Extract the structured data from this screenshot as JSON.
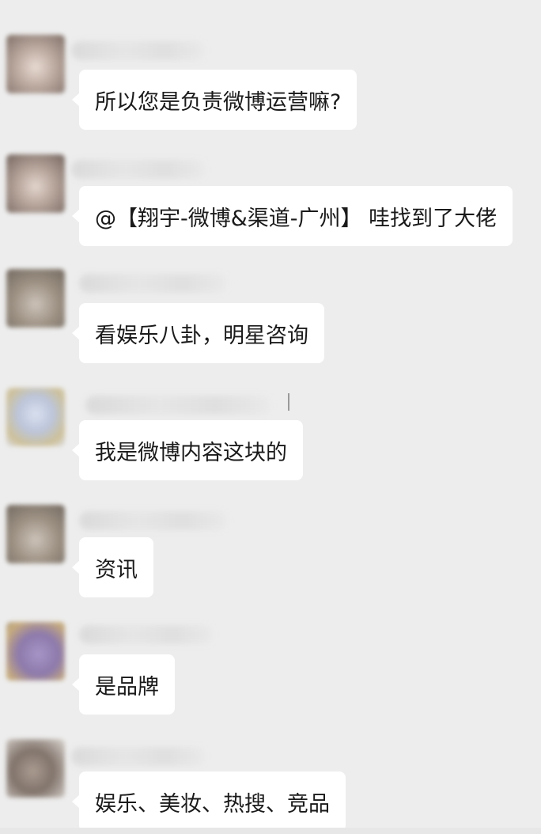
{
  "messages": [
    {
      "text": "所以您是负责微博运营嘛?",
      "avatar_color": "#b9a79c"
    },
    {
      "text": "@【翔宇-微博&渠道-广州】 哇找到了大佬",
      "avatar_color": "#a99486"
    },
    {
      "text": "看娱乐八卦，明星咨询",
      "avatar_color": "#8f8374"
    },
    {
      "text": "我是微博内容这块的",
      "avatar_color": "#b7c2d8"
    },
    {
      "text": "资讯",
      "avatar_color": "#8f8374"
    },
    {
      "text": "是品牌",
      "avatar_color": "#8a72a8"
    },
    {
      "text": "娱乐、美妆、热搜、竞品",
      "avatar_color": "#7d6c62"
    }
  ],
  "colors": {
    "background": "#ededed",
    "bubble": "#ffffff",
    "text": "#1a1a1a"
  }
}
